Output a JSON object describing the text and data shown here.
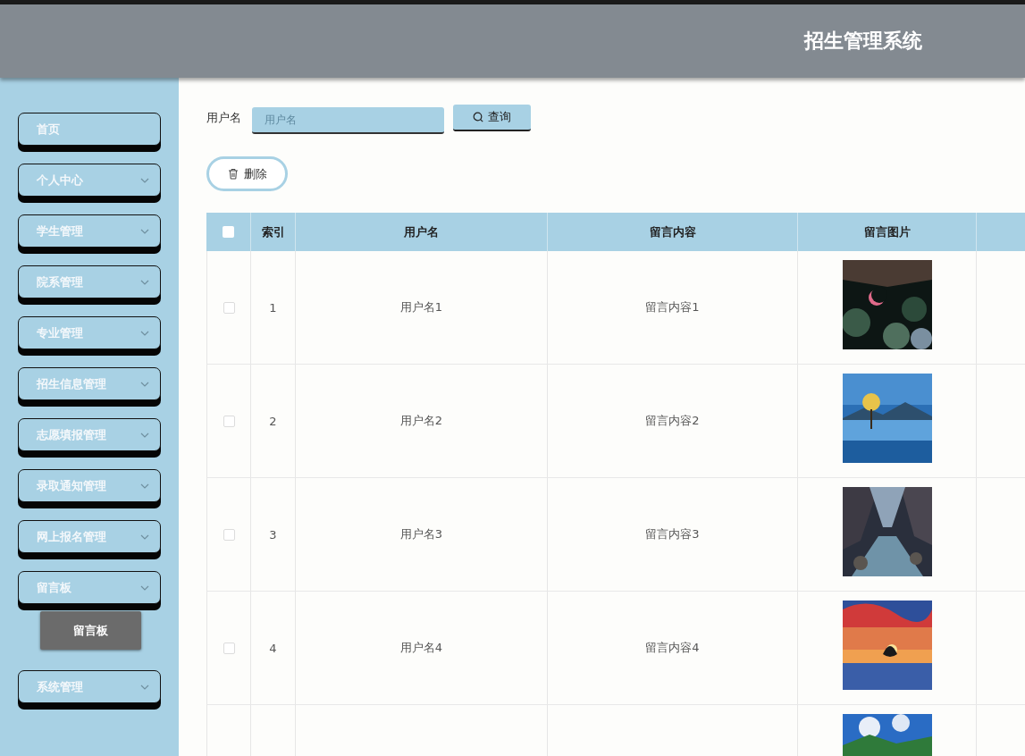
{
  "header": {
    "title": "招生管理系统"
  },
  "sidebar": {
    "items": [
      {
        "kind": "link",
        "label": "首页"
      },
      {
        "kind": "menu",
        "label": "个人中心",
        "expanded": false
      },
      {
        "kind": "menu",
        "label": "学生管理",
        "expanded": false
      },
      {
        "kind": "menu",
        "label": "院系管理",
        "expanded": false
      },
      {
        "kind": "menu",
        "label": "专业管理",
        "expanded": false
      },
      {
        "kind": "menu",
        "label": "招生信息管理",
        "expanded": false
      },
      {
        "kind": "menu",
        "label": "志愿填报管理",
        "expanded": false
      },
      {
        "kind": "menu",
        "label": "录取通知管理",
        "expanded": false
      },
      {
        "kind": "menu",
        "label": "网上报名管理",
        "expanded": false
      },
      {
        "kind": "menu",
        "label": "留言板",
        "expanded": true,
        "children": [
          {
            "label": "留言板"
          }
        ]
      },
      {
        "kind": "menu",
        "label": "系统管理",
        "expanded": false
      }
    ]
  },
  "search": {
    "label": "用户名",
    "placeholder": "用户名",
    "button": "查询"
  },
  "actions": {
    "delete": "删除"
  },
  "table": {
    "all_selected": false,
    "columns": [
      "索引",
      "用户名",
      "留言内容",
      "留言图片"
    ],
    "rows": [
      {
        "selected": false,
        "index": "1",
        "username": "用户名1",
        "content": "留言内容1",
        "image": {
          "kind": "picture"
        }
      },
      {
        "selected": false,
        "index": "2",
        "username": "用户名2",
        "content": "留言内容2",
        "image": {
          "kind": "picture"
        }
      },
      {
        "selected": false,
        "index": "3",
        "username": "用户名3",
        "content": "留言内容3",
        "image": {
          "kind": "picture"
        }
      },
      {
        "selected": false,
        "index": "4",
        "username": "用户名4",
        "content": "留言内容4",
        "image": {
          "kind": "picture"
        }
      },
      {
        "image": {
          "kind": "picture"
        }
      }
    ]
  }
}
